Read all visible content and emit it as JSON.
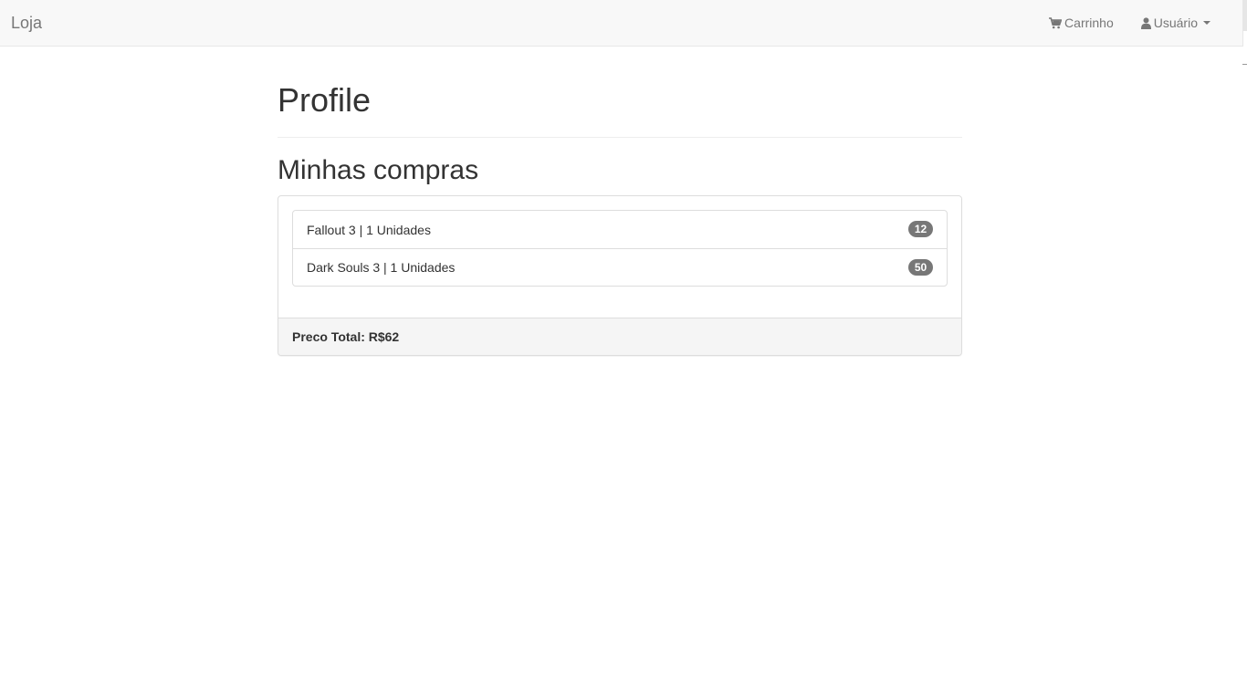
{
  "navbar": {
    "brand": "Loja",
    "cart_label": "Carrinho",
    "cart_icon": "shopping-cart-icon",
    "user_label": "Usuário",
    "user_icon": "user-icon"
  },
  "page": {
    "title": "Profile",
    "section_title": "Minhas compras"
  },
  "purchases": [
    {
      "label": "Fallout 3 | 1 Unidades",
      "badge": "12"
    },
    {
      "label": "Dark Souls 3 | 1 Unidades",
      "badge": "50"
    }
  ],
  "footer": {
    "total_text": "Preco Total: R$62"
  },
  "colors": {
    "navbar_bg": "#f8f8f8",
    "badge_bg": "#777777",
    "text": "#333333",
    "muted": "#777777"
  }
}
